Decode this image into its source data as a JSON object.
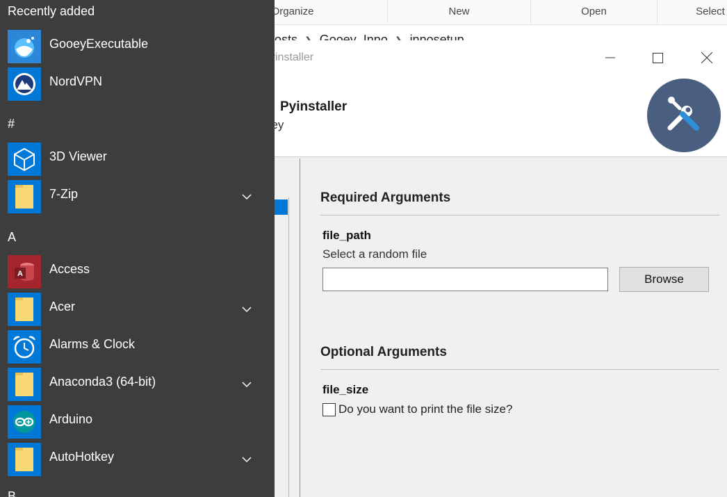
{
  "explorer": {
    "ribbon": [
      "Organize",
      "New",
      "Open",
      "Select"
    ],
    "breadcrumb": [
      "osts",
      "Gooey_Inno",
      "innosetup"
    ]
  },
  "window": {
    "title": "yinstaller",
    "program_title": "Pyinstaller",
    "program_description": "oey"
  },
  "config": {
    "required_title": "Required Arguments",
    "file_path_label": "file_path",
    "file_path_help": "Select a random file",
    "file_path_value": "",
    "browse_label": "Browse",
    "optional_title": "Optional Arguments",
    "file_size_label": "file_size",
    "file_size_checkbox": "Do you want to print the file size?"
  },
  "start_menu": {
    "recently_added": "Recently added",
    "recent": [
      {
        "label": "GooeyExecutable",
        "icon": "gooey-app-icon"
      },
      {
        "label": "NordVPN",
        "icon": "nordvpn-icon"
      }
    ],
    "group_hash": "#",
    "hash_items": [
      {
        "label": "3D Viewer",
        "icon": "cube-icon"
      },
      {
        "label": "7-Zip",
        "icon": "folder-icon"
      }
    ],
    "group_a": "A",
    "a_items": [
      {
        "label": "Access",
        "icon": "access-icon"
      },
      {
        "label": "Acer",
        "icon": "folder-icon"
      },
      {
        "label": "Alarms & Clock",
        "icon": "alarm-clock-icon"
      },
      {
        "label": "Anaconda3 (64-bit)",
        "icon": "folder-icon"
      },
      {
        "label": "Arduino",
        "icon": "arduino-icon"
      },
      {
        "label": "AutoHotkey",
        "icon": "folder-icon"
      }
    ],
    "group_b": "B"
  },
  "colors": {
    "accent": "#0078d7",
    "start_bg": "#3d3d3d",
    "logo_bg": "#4a5e80",
    "access_red": "#a4262c",
    "folder": "#f8d775",
    "arduino": "#00979d"
  }
}
